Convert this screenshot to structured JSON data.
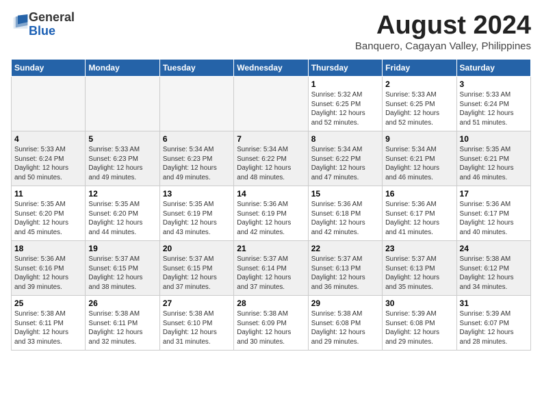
{
  "logo": {
    "general": "General",
    "blue": "Blue"
  },
  "title": "August 2024",
  "subtitle": "Banquero, Cagayan Valley, Philippines",
  "days_of_week": [
    "Sunday",
    "Monday",
    "Tuesday",
    "Wednesday",
    "Thursday",
    "Friday",
    "Saturday"
  ],
  "weeks": [
    {
      "shaded": false,
      "days": [
        {
          "day": "",
          "info": ""
        },
        {
          "day": "",
          "info": ""
        },
        {
          "day": "",
          "info": ""
        },
        {
          "day": "",
          "info": ""
        },
        {
          "day": "1",
          "info": "Sunrise: 5:32 AM\nSunset: 6:25 PM\nDaylight: 12 hours\nand 52 minutes."
        },
        {
          "day": "2",
          "info": "Sunrise: 5:33 AM\nSunset: 6:25 PM\nDaylight: 12 hours\nand 52 minutes."
        },
        {
          "day": "3",
          "info": "Sunrise: 5:33 AM\nSunset: 6:24 PM\nDaylight: 12 hours\nand 51 minutes."
        }
      ]
    },
    {
      "shaded": true,
      "days": [
        {
          "day": "4",
          "info": "Sunrise: 5:33 AM\nSunset: 6:24 PM\nDaylight: 12 hours\nand 50 minutes."
        },
        {
          "day": "5",
          "info": "Sunrise: 5:33 AM\nSunset: 6:23 PM\nDaylight: 12 hours\nand 49 minutes."
        },
        {
          "day": "6",
          "info": "Sunrise: 5:34 AM\nSunset: 6:23 PM\nDaylight: 12 hours\nand 49 minutes."
        },
        {
          "day": "7",
          "info": "Sunrise: 5:34 AM\nSunset: 6:22 PM\nDaylight: 12 hours\nand 48 minutes."
        },
        {
          "day": "8",
          "info": "Sunrise: 5:34 AM\nSunset: 6:22 PM\nDaylight: 12 hours\nand 47 minutes."
        },
        {
          "day": "9",
          "info": "Sunrise: 5:34 AM\nSunset: 6:21 PM\nDaylight: 12 hours\nand 46 minutes."
        },
        {
          "day": "10",
          "info": "Sunrise: 5:35 AM\nSunset: 6:21 PM\nDaylight: 12 hours\nand 46 minutes."
        }
      ]
    },
    {
      "shaded": false,
      "days": [
        {
          "day": "11",
          "info": "Sunrise: 5:35 AM\nSunset: 6:20 PM\nDaylight: 12 hours\nand 45 minutes."
        },
        {
          "day": "12",
          "info": "Sunrise: 5:35 AM\nSunset: 6:20 PM\nDaylight: 12 hours\nand 44 minutes."
        },
        {
          "day": "13",
          "info": "Sunrise: 5:35 AM\nSunset: 6:19 PM\nDaylight: 12 hours\nand 43 minutes."
        },
        {
          "day": "14",
          "info": "Sunrise: 5:36 AM\nSunset: 6:19 PM\nDaylight: 12 hours\nand 42 minutes."
        },
        {
          "day": "15",
          "info": "Sunrise: 5:36 AM\nSunset: 6:18 PM\nDaylight: 12 hours\nand 42 minutes."
        },
        {
          "day": "16",
          "info": "Sunrise: 5:36 AM\nSunset: 6:17 PM\nDaylight: 12 hours\nand 41 minutes."
        },
        {
          "day": "17",
          "info": "Sunrise: 5:36 AM\nSunset: 6:17 PM\nDaylight: 12 hours\nand 40 minutes."
        }
      ]
    },
    {
      "shaded": true,
      "days": [
        {
          "day": "18",
          "info": "Sunrise: 5:36 AM\nSunset: 6:16 PM\nDaylight: 12 hours\nand 39 minutes."
        },
        {
          "day": "19",
          "info": "Sunrise: 5:37 AM\nSunset: 6:15 PM\nDaylight: 12 hours\nand 38 minutes."
        },
        {
          "day": "20",
          "info": "Sunrise: 5:37 AM\nSunset: 6:15 PM\nDaylight: 12 hours\nand 37 minutes."
        },
        {
          "day": "21",
          "info": "Sunrise: 5:37 AM\nSunset: 6:14 PM\nDaylight: 12 hours\nand 37 minutes."
        },
        {
          "day": "22",
          "info": "Sunrise: 5:37 AM\nSunset: 6:13 PM\nDaylight: 12 hours\nand 36 minutes."
        },
        {
          "day": "23",
          "info": "Sunrise: 5:37 AM\nSunset: 6:13 PM\nDaylight: 12 hours\nand 35 minutes."
        },
        {
          "day": "24",
          "info": "Sunrise: 5:38 AM\nSunset: 6:12 PM\nDaylight: 12 hours\nand 34 minutes."
        }
      ]
    },
    {
      "shaded": false,
      "days": [
        {
          "day": "25",
          "info": "Sunrise: 5:38 AM\nSunset: 6:11 PM\nDaylight: 12 hours\nand 33 minutes."
        },
        {
          "day": "26",
          "info": "Sunrise: 5:38 AM\nSunset: 6:11 PM\nDaylight: 12 hours\nand 32 minutes."
        },
        {
          "day": "27",
          "info": "Sunrise: 5:38 AM\nSunset: 6:10 PM\nDaylight: 12 hours\nand 31 minutes."
        },
        {
          "day": "28",
          "info": "Sunrise: 5:38 AM\nSunset: 6:09 PM\nDaylight: 12 hours\nand 30 minutes."
        },
        {
          "day": "29",
          "info": "Sunrise: 5:38 AM\nSunset: 6:08 PM\nDaylight: 12 hours\nand 29 minutes."
        },
        {
          "day": "30",
          "info": "Sunrise: 5:39 AM\nSunset: 6:08 PM\nDaylight: 12 hours\nand 29 minutes."
        },
        {
          "day": "31",
          "info": "Sunrise: 5:39 AM\nSunset: 6:07 PM\nDaylight: 12 hours\nand 28 minutes."
        }
      ]
    }
  ]
}
